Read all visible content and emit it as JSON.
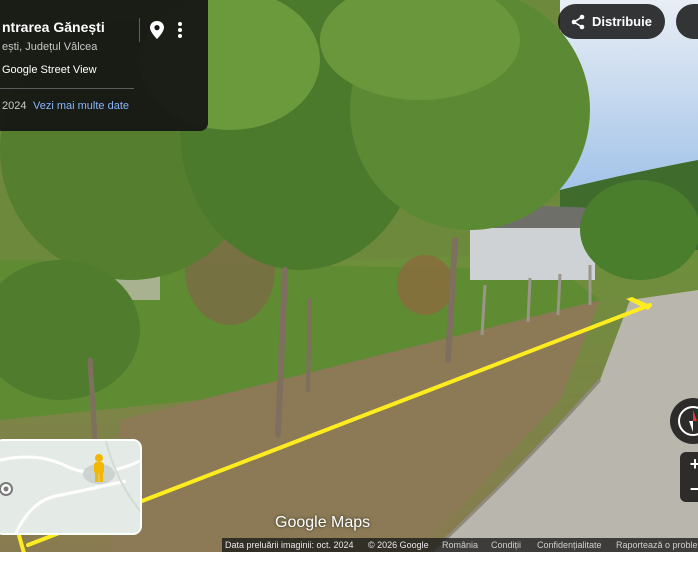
{
  "place": {
    "title": "ntrarea Gănești",
    "subtitle": "ești, Județul Vâlcea",
    "source": "Google Street View",
    "year": "2024",
    "more_dates_link": "Vezi mai multe date"
  },
  "share": {
    "label": "Distribuie"
  },
  "zoom": {
    "in_label": "+",
    "out_label": "−"
  },
  "logo": {
    "text": "Google Maps"
  },
  "footer": {
    "image_date": "Data preluării imaginii: oct. 2024",
    "copyright": "© 2026 Google",
    "country": "România",
    "terms": "Condiții",
    "privacy": "Confidențialitate",
    "report": "Raportează o proble"
  },
  "colors": {
    "annotation_line": "#ffec1f",
    "panel_bg": "#141414",
    "link": "#8ab4f8"
  }
}
